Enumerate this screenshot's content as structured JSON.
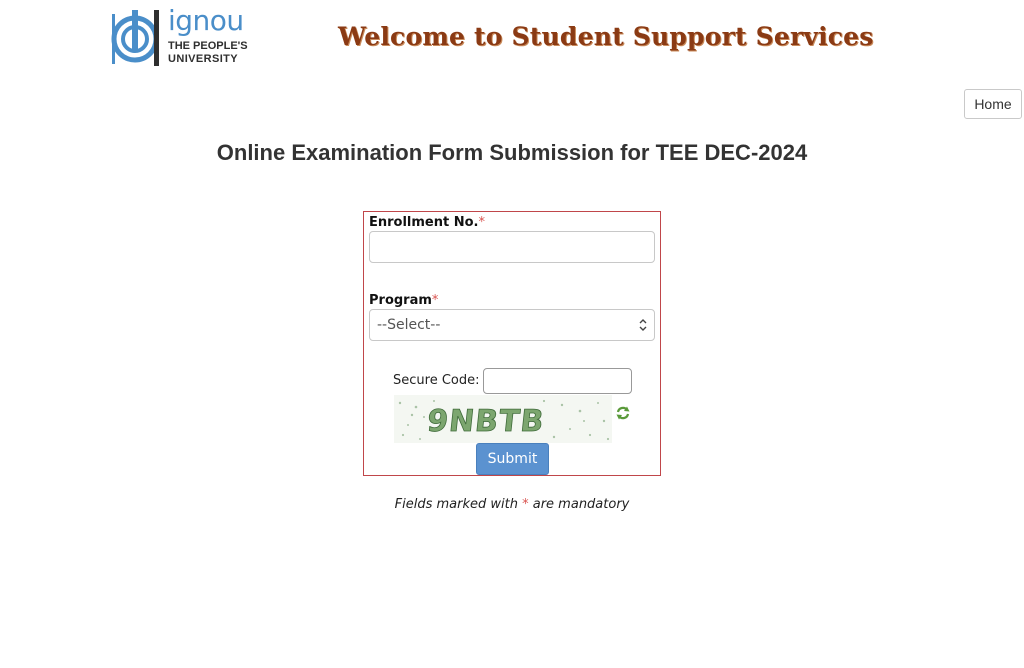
{
  "header": {
    "logo": {
      "wordmark": "ignou",
      "tagline_1": "THE PEOPLE'S",
      "tagline_2": "UNIVERSITY"
    },
    "title": "Welcome to Student Support Services",
    "title_color": "#8a3a14"
  },
  "nav": {
    "home_label": "Home"
  },
  "page": {
    "title": "Online Examination Form Submission for TEE DEC-2024"
  },
  "form": {
    "enrollment": {
      "label": "Enrollment No.",
      "required_mark": "*",
      "value": ""
    },
    "program": {
      "label": "Program",
      "required_mark": "*",
      "selected": "--Select--"
    },
    "secure_code": {
      "label": "Secure Code:",
      "value": "",
      "captcha_text": "9NBTB"
    },
    "submit_label": "Submit"
  },
  "footer_note": {
    "before": "Fields marked with ",
    "mark": "*",
    "after": " are mandatory"
  },
  "colors": {
    "accent": "#5b92d0",
    "required": "#d9534f",
    "form_border": "#c0464a",
    "logo_blue": "#4a8ec9"
  }
}
